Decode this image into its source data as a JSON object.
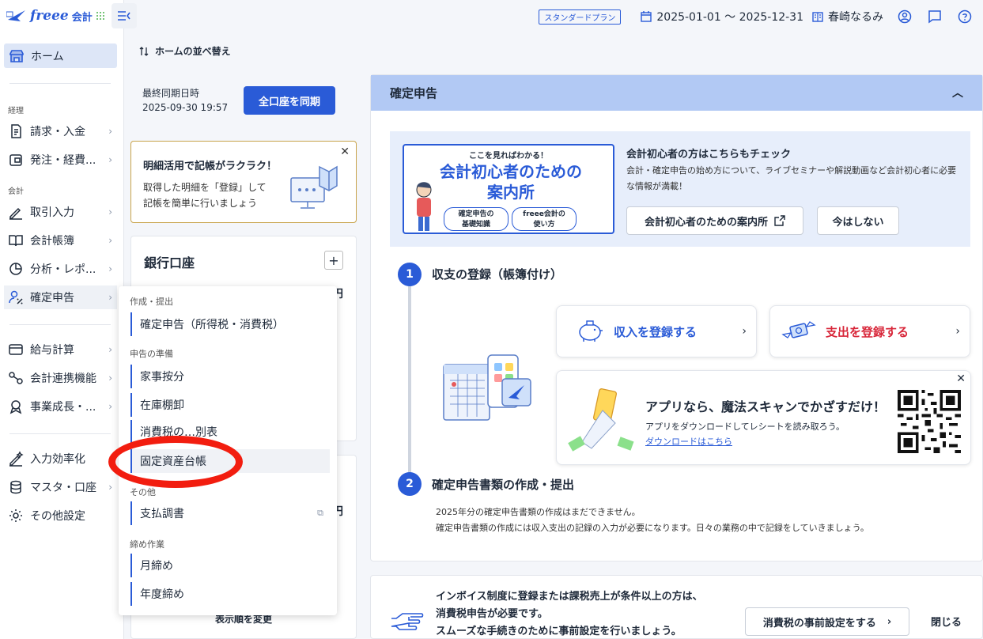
{
  "app": {
    "brand": "freee",
    "brand_sub": "会計"
  },
  "topbar": {
    "plan": "スタンダードプラン",
    "period": "2025-01-01 〜 2025-12-31",
    "company": "春崎なるみ"
  },
  "sidebar": {
    "home": "ホーム",
    "sections": {
      "keiri": "経理",
      "kaikei": "会計"
    },
    "items": [
      {
        "label": "請求・入金"
      },
      {
        "label": "発注・経費..."
      },
      {
        "label": "取引入力"
      },
      {
        "label": "会計帳簿"
      },
      {
        "label": "分析・レポ..."
      },
      {
        "label": "確定申告"
      },
      {
        "label": "給与計算"
      },
      {
        "label": "会計連携機能"
      },
      {
        "label": "事業成長・..."
      },
      {
        "label": "入力効率化"
      },
      {
        "label": "マスタ・口座"
      },
      {
        "label": "その他設定"
      }
    ]
  },
  "home": {
    "sort_label": "ホームの並べ替え",
    "sync_label_line1": "最終同期日時",
    "sync_label_line2": "2025-09-30 19:57",
    "sync_button": "全口座を同期",
    "tip_title": "明細活用で記帳がラクラク！",
    "tip_line1": "取得した明細を「登録」して",
    "tip_line2": "記帳を簡単に行いましょう",
    "bank_title": "銀行口座",
    "bank_amount_unit": "円",
    "card2_amount_unit": "円",
    "reorder": "表示順を変更"
  },
  "dropdown": {
    "section1": "作成・提出",
    "item1": "確定申告（所得税・消費税）",
    "section2": "申告の準備",
    "item2": "家事按分",
    "item3": "在庫棚卸",
    "item4": "消費税の…別表",
    "item5": "固定資産台帳",
    "section3": "その他",
    "item6": "支払調書",
    "section4": "締め作業",
    "item7": "月締め",
    "item8": "年度締め"
  },
  "tax": {
    "header": "確定申告",
    "promo": {
      "banner_top": "ここを見ればわかる！",
      "banner_main1": "会計初心者のための",
      "banner_main2": "案内所",
      "chip1_line1": "確定申告の",
      "chip1_line2": "基礎知識",
      "chip2_line1": "freee会計の",
      "chip2_line2": "使い方",
      "title": "会計初心者の方はこちらもチェック",
      "desc": "会計・確定申告の始め方について、ライブセミナーや解説動画など会計初心者に必要な情報が満載！",
      "guide_button": "会計初心者のための案内所",
      "later_button": "今はしない"
    },
    "step1_num": "1",
    "step1_title": "収支の登録（帳簿付け）",
    "income_button": "収入を登録する",
    "expense_button": "支出を登録する",
    "app_title": "アプリなら、魔法スキャンでかざすだけ！",
    "app_desc": "アプリをダウンロードしてレシートを読み取ろう。",
    "app_link": "ダウンロードはこちら",
    "step2_num": "2",
    "step2_title": "確定申告書類の作成・提出",
    "step2_line1": "2025年分の確定申告書類の作成はまだできません。",
    "step2_line2": "確定申告書類の作成には収入支出の記録の入力が必要になります。日々の業務の中で記録をしていきましょう。"
  },
  "invoice": {
    "line1": "インボイス制度に登録または課税売上が条件以上の方は、",
    "line2": "消費税申告が必要です。",
    "line3": "スムーズな手続きのために事前設定を行いましょう。",
    "button": "消費税の事前設定をする",
    "close": "閉じる"
  },
  "colors": {
    "accent": "#2a5bd7",
    "header": "#b2c9f4",
    "expense": "#d8273a",
    "highlight": "#f21d0f"
  }
}
